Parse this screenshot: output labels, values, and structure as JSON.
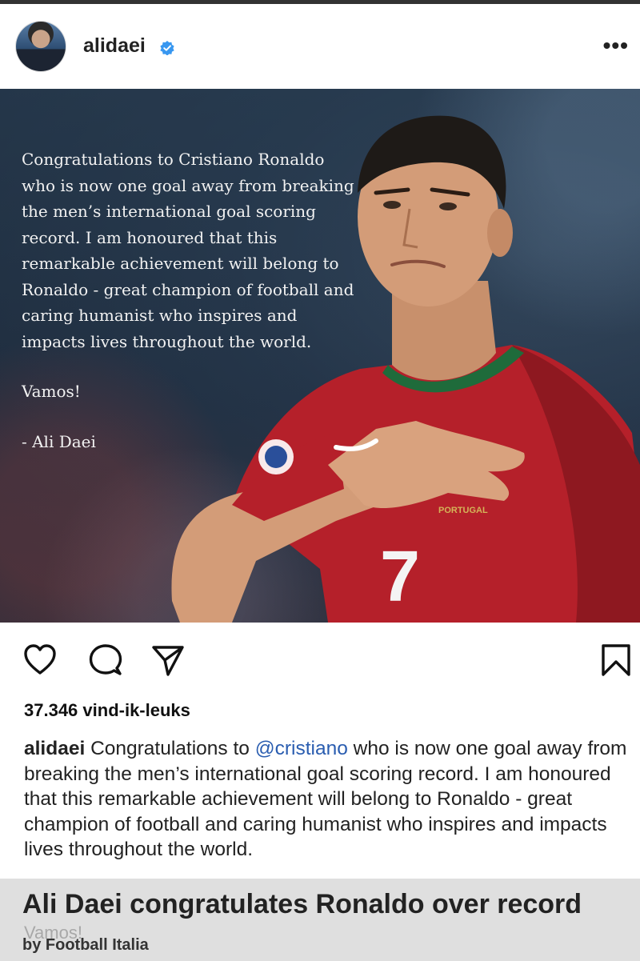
{
  "post": {
    "username": "alidaei",
    "verified": true,
    "more_label": "•••"
  },
  "image_text": {
    "paragraph": "Congratulations to Cristiano Ronaldo who is now one goal away from breaking the men’s international goal scoring record. I am honoured that this remarkable achievement will belong to Ronaldo - great champion of football and caring humanist who inspires and impacts lives throughout the world.",
    "exclaim": "Vamos!",
    "signature": "- Ali Daei"
  },
  "likes": "37.346 vind-ik-leuks",
  "caption": {
    "user": "alidaei",
    "before_mention": " Congratulations to ",
    "mention": "@cristiano",
    "after_mention": " who is now one goal away from breaking the men’s international goal scoring record. I am honoured that this remarkable achievement will belong to Ronaldo - great champion of football and caring humanist who inspires and impacts lives throughout the world.",
    "partial_line": "Vamos!"
  },
  "banner": {
    "title": "Ali Daei congratulates Ronaldo over record",
    "byline": "by Football Italia"
  },
  "jersey": {
    "number": "7"
  },
  "icons": [
    "heart-icon",
    "comment-icon",
    "share-icon",
    "bookmark-icon",
    "verified-badge-icon",
    "more-options-icon"
  ],
  "colors": {
    "verified": "#3897f0",
    "mention": "#2a5db0",
    "jersey": "#b5202a"
  }
}
